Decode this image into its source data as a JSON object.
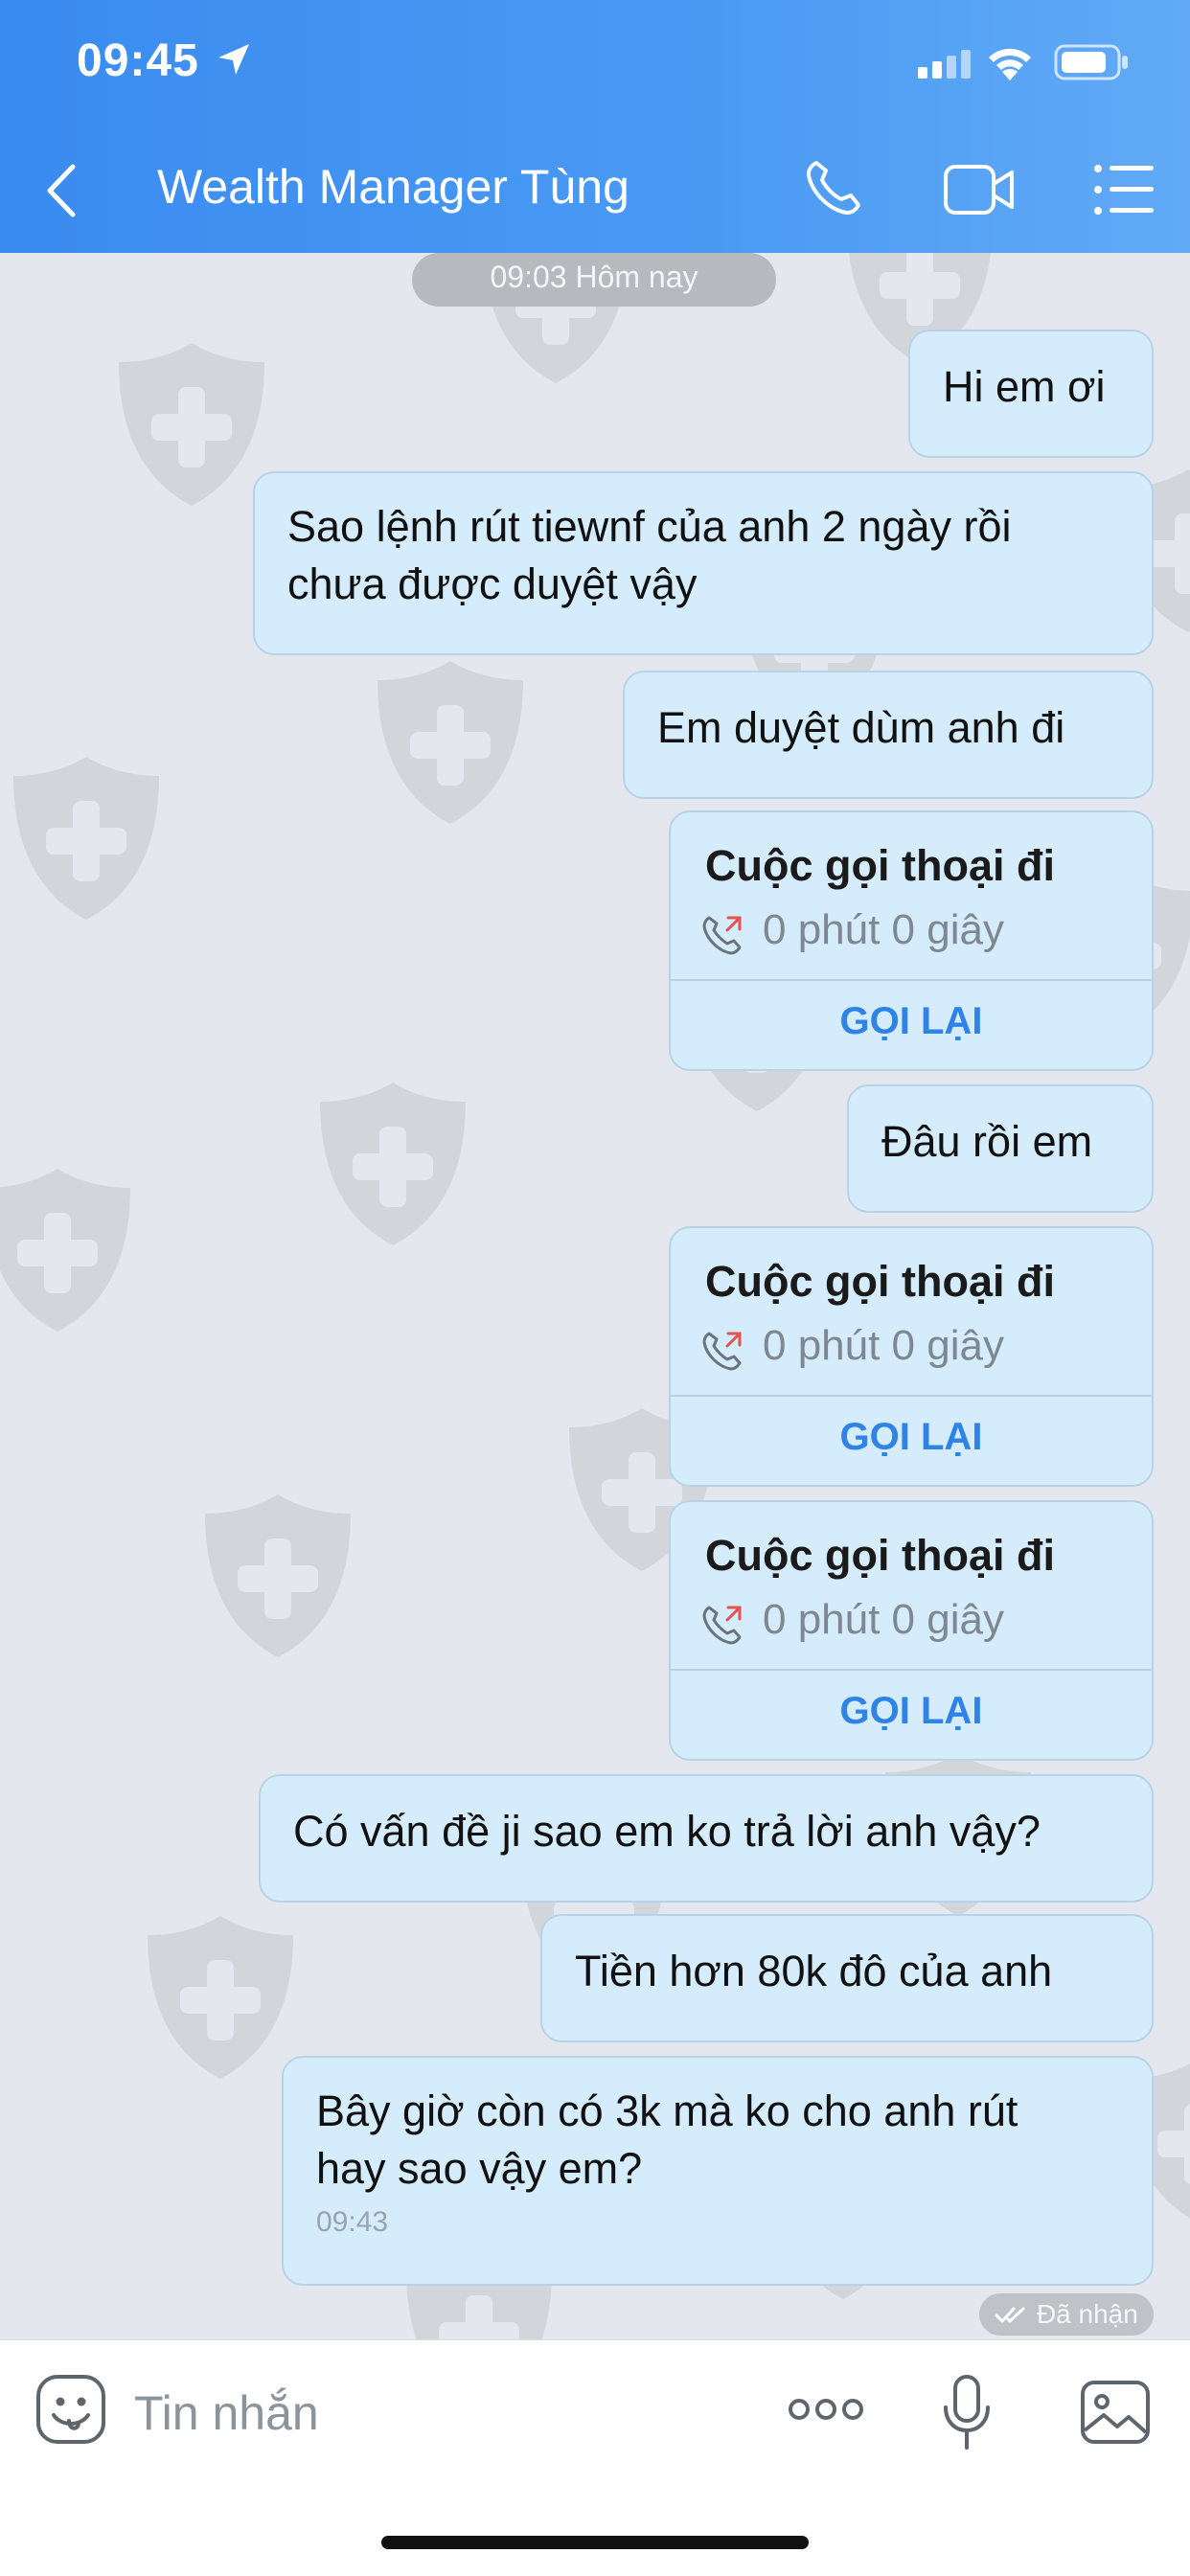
{
  "status_bar": {
    "time": "09:45"
  },
  "header": {
    "title": "Wealth Manager Tùng"
  },
  "chat": {
    "date_divider": "09:03 Hôm nay",
    "messages": [
      {
        "text": "Hi em ơi"
      },
      {
        "line1": "Sao lệnh rút tiewnf của anh 2 ngày rồi",
        "line2": "chưa được duyệt vậy"
      },
      {
        "text": "Em duyệt dùm anh đi"
      },
      {
        "title": "Cuộc gọi thoại đi",
        "duration": "0 phút 0 giây",
        "action": "GỌI LẠI"
      },
      {
        "text": "Đâu rồi em"
      },
      {
        "title": "Cuộc gọi thoại đi",
        "duration": "0 phút 0 giây",
        "action": "GỌI LẠI"
      },
      {
        "title": "Cuộc gọi thoại đi",
        "duration": "0 phút 0 giây",
        "action": "GỌI LẠI"
      },
      {
        "text": "Có vấn đề ji sao em ko trả lời anh vậy?"
      },
      {
        "text": "Tiền hơn 80k đô của anh"
      },
      {
        "line1": "Bây giờ còn có 3k mà ko cho anh rút",
        "line2": "hay sao vậy em?",
        "time": "09:43"
      }
    ],
    "status": "Đã nhận"
  },
  "composer": {
    "placeholder": "Tin nhắn"
  },
  "colors": {
    "header": "#3a8bf0",
    "bubble": "#d4ecfb",
    "link": "#2f83e6",
    "background": "#e4e8ee"
  },
  "icons": [
    "back-icon",
    "phone-icon",
    "video-icon",
    "menu-icon",
    "sticker-icon",
    "more-icon",
    "mic-icon",
    "image-icon",
    "outgoing-call-icon"
  ]
}
